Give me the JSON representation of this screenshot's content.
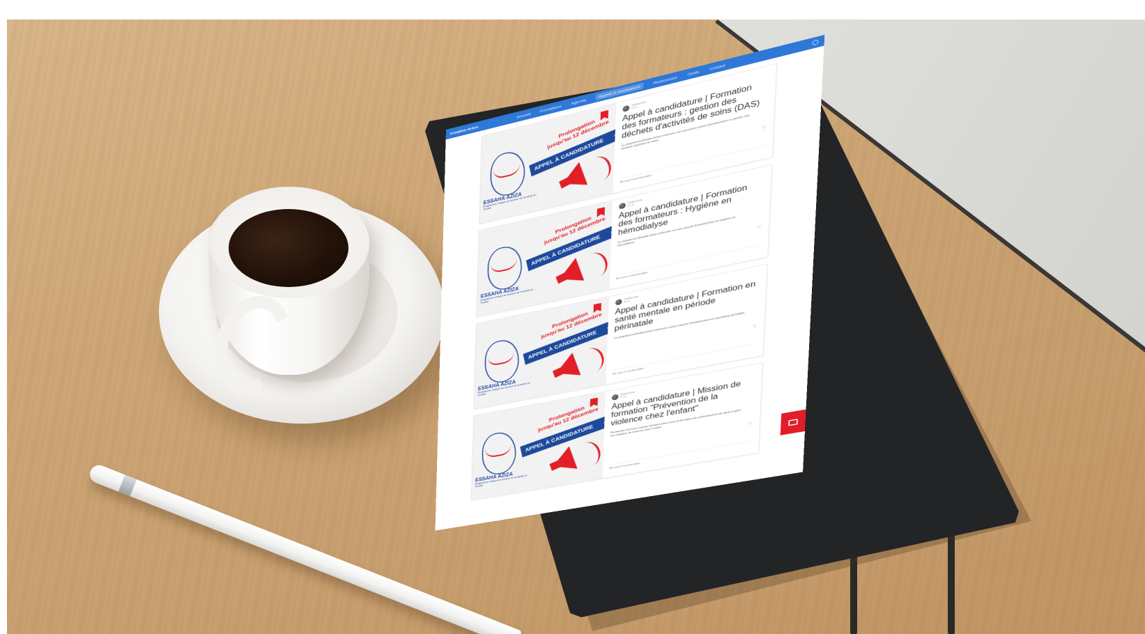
{
  "nav": {
    "brand": "Creative Arbre",
    "items": [
      "Accueil",
      "Formations",
      "Agenda",
      "Appels à candidature",
      "Ressources",
      "Outils",
      "Contact"
    ]
  },
  "posts": [
    {
      "author": "Daaha Azia",
      "date": "il y a",
      "title": "Appel à candidature | Formation des formateurs : gestion des déchets d'activités de soins (DAS)",
      "excerpt": "Le programme Essaha Aziza recherche une experte/un expert formatrice/teur en gestion des déchets d'activités de soins.",
      "foot": "98 vues   0 commentaire"
    },
    {
      "author": "Daaha Azia",
      "date": "il y a",
      "title": "Appel à candidature | Formation des formateurs : Hygiène en hémodialyse",
      "excerpt": "Le programme Essaha Aziza recherche un/ une experte formatrice/teur en hygiène en hémodialyse.",
      "foot": "84 vues   0 commentaire"
    },
    {
      "author": "Daaha Azia",
      "date": "il y a",
      "title": "Appel à candidature | Formation en santé mentale en période périnatale",
      "excerpt": "Le programme Essaha Aziza recherche un/une experte formatrice/teur en psychiatrie périnatale.",
      "foot": "96 vues   0 commentaire"
    },
    {
      "author": "Daaha Azia",
      "date": "il y a",
      "title": "Appel à candidature | Mission de formation \"Prévention de la violence chez l'enfant\"",
      "excerpt": "Recherche d'un/une experte formatrice/teur pour la formation de professionnels de santé à gérer une situation de violence chez l'enfant.",
      "foot": "98 vues   0 commentaire"
    }
  ],
  "poster": {
    "prolong_1": "Prolongation",
    "prolong_2": "jusqu'au 12 décembre",
    "banner": "APPEL À CANDIDATURE",
    "org": "ESSAHA AZIZA",
    "org_sub": "Programme d'appui au secteur de la santé en Tunisie"
  },
  "colors": {
    "nav_blue": "#2e78d8",
    "poster_red": "#e21f26",
    "poster_blue": "#1e4a9c"
  },
  "icons": {
    "fab": "message-icon",
    "heart": "heart-icon",
    "megaphone": "megaphone-icon"
  }
}
